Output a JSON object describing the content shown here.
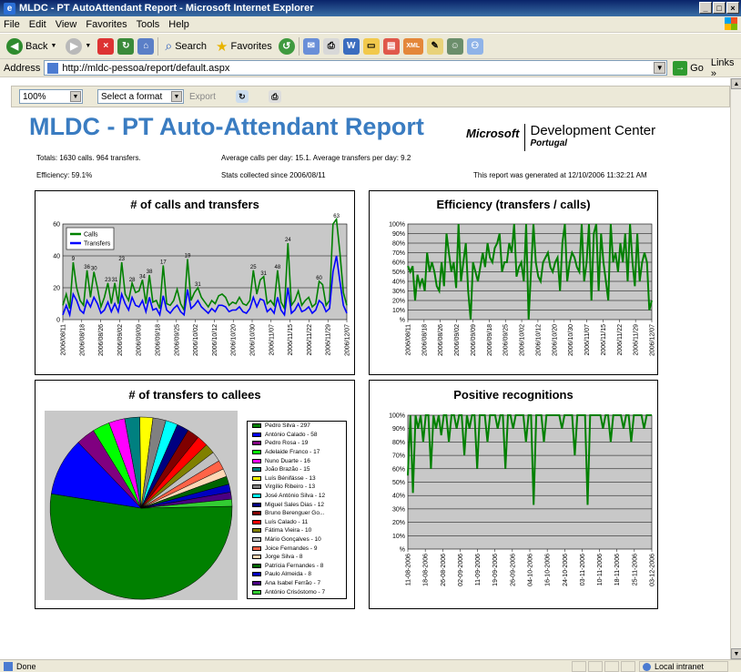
{
  "window": {
    "title": "MLDC - PT AutoAttendant Report - Microsoft Internet Explorer"
  },
  "menu": [
    "File",
    "Edit",
    "View",
    "Favorites",
    "Tools",
    "Help"
  ],
  "toolbar": {
    "back": "Back",
    "search": "Search",
    "favorites": "Favorites"
  },
  "address": {
    "label": "Address",
    "url": "http://mldc-pessoa/report/default.aspx",
    "go": "Go",
    "links": "Links"
  },
  "report_toolbar": {
    "zoom": "100%",
    "format": "Select a format",
    "export": "Export"
  },
  "report": {
    "title": "MLDC - PT Auto-Attendant Report",
    "logo": {
      "microsoft": "Microsoft",
      "dc": "Development Center",
      "country": "Portugal"
    },
    "totals": "Totals: 1630 calls. 964 transfers.",
    "averages": "Average calls per day: 15.1. Average transfers per day: 9.2",
    "efficiency": "Efficiency: 59.1%",
    "since": "Stats collected since 2006/08/11",
    "generated": "This report was generated at 12/10/2006 11:32:21 AM"
  },
  "chart_data": [
    {
      "type": "line",
      "title": "# of calls and transfers",
      "x_ticks": [
        "2006/08/11",
        "2006/08/18",
        "2006/08/26",
        "2006/09/02",
        "2006/09/09",
        "2006/09/18",
        "2006/09/25",
        "2006/10/02",
        "2006/10/12",
        "2006/10/20",
        "2006/10/30",
        "2006/11/07",
        "2006/11/15",
        "2006/11/22",
        "2006/11/29",
        "2006/12/07"
      ],
      "ylim": [
        0,
        60
      ],
      "y_ticks": [
        "0",
        "20",
        "40",
        "60"
      ],
      "legend_position": "top-left",
      "series": [
        {
          "name": "Calls",
          "color": "#008000",
          "values": [
            9,
            16,
            7,
            36,
            20,
            12,
            9,
            31,
            14,
            30,
            20,
            8,
            14,
            23,
            10,
            23,
            10,
            36,
            16,
            12,
            23,
            17,
            18,
            25,
            10,
            28,
            11,
            12,
            7,
            34,
            10,
            9,
            12,
            19,
            10,
            6,
            38,
            12,
            17,
            20,
            14,
            11,
            8,
            12,
            10,
            15,
            16,
            14,
            9,
            11,
            10,
            14,
            10,
            9,
            12,
            31,
            16,
            25,
            27,
            10,
            12,
            9,
            31,
            11,
            7,
            48,
            9,
            12,
            18,
            9,
            12,
            14,
            8,
            10,
            24,
            22,
            9,
            12,
            60,
            63,
            42,
            17,
            9
          ]
        },
        {
          "name": "Transfers",
          "color": "#0000ff",
          "values": [
            3,
            9,
            3,
            16,
            12,
            6,
            4,
            12,
            8,
            14,
            10,
            4,
            6,
            11,
            5,
            10,
            5,
            16,
            10,
            6,
            14,
            9,
            8,
            12,
            5,
            14,
            6,
            7,
            3,
            15,
            6,
            4,
            7,
            9,
            5,
            3,
            19,
            7,
            9,
            12,
            8,
            6,
            4,
            7,
            5,
            9,
            9,
            8,
            5,
            6,
            6,
            8,
            5,
            4,
            7,
            14,
            8,
            13,
            12,
            5,
            7,
            4,
            14,
            6,
            3,
            20,
            4,
            6,
            10,
            5,
            6,
            8,
            4,
            6,
            12,
            10,
            5,
            7,
            30,
            40,
            24,
            9,
            4
          ]
        }
      ],
      "data_labels": [
        "9",
        "36",
        "30",
        "23",
        "31",
        "23",
        "28",
        "34",
        "38",
        "17",
        "19",
        "31",
        "25",
        "31",
        "48",
        "24",
        "60",
        "63"
      ]
    },
    {
      "type": "line",
      "title": "Efficiency (transfers / calls)",
      "x_ticks": [
        "2006/08/11",
        "2006/08/18",
        "2006/08/26",
        "2006/09/02",
        "2006/09/09",
        "2006/09/18",
        "2006/09/25",
        "2006/10/02",
        "2006/10/12",
        "2006/10/20",
        "2006/10/30",
        "2006/11/07",
        "2006/11/15",
        "2006/11/22",
        "2006/11/29",
        "2006/12/07"
      ],
      "ylim": [
        0,
        100
      ],
      "y_ticks": [
        "%",
        "10%",
        "20%",
        "30%",
        "40%",
        "50%",
        "60%",
        "70%",
        "80%",
        "90%",
        "100%"
      ],
      "grid": true,
      "series": [
        {
          "name": "",
          "color": "#008000",
          "values": [
            56,
            50,
            56,
            20,
            47,
            35,
            43,
            30,
            70,
            50,
            60,
            50,
            35,
            30,
            60,
            35,
            90,
            70,
            50,
            60,
            33,
            100,
            40,
            60,
            80,
            30,
            0,
            60,
            50,
            40,
            55,
            70,
            55,
            80,
            65,
            60,
            75,
            80,
            90,
            50,
            60,
            60,
            80,
            70,
            100,
            45,
            55,
            60,
            40,
            100,
            0,
            50,
            100,
            60,
            45,
            40,
            60,
            65,
            70,
            55,
            50,
            60,
            65,
            30,
            80,
            100,
            40,
            60,
            70,
            65,
            55,
            50,
            100,
            40,
            60,
            100,
            20,
            90,
            100,
            30,
            90,
            60,
            40,
            20,
            100,
            60,
            70,
            50,
            80,
            60,
            90,
            40,
            100,
            60,
            35,
            90,
            40,
            60,
            70,
            60,
            10,
            20
          ]
        }
      ]
    },
    {
      "type": "pie",
      "title": "# of transfers to callees",
      "legend_position": "right",
      "slices": [
        {
          "label": "Pedro Silva - 297",
          "value": 297,
          "color": "#008000"
        },
        {
          "label": "António Calado - 58",
          "value": 58,
          "color": "#0000ff"
        },
        {
          "label": "Pedro Rosa - 19",
          "value": 19,
          "color": "#800080"
        },
        {
          "label": "Adelaide Franco - 17",
          "value": 17,
          "color": "#00ff00"
        },
        {
          "label": "Nuno Duarte - 16",
          "value": 16,
          "color": "#ff00ff"
        },
        {
          "label": "João Brazão - 15",
          "value": 15,
          "color": "#008080"
        },
        {
          "label": "Luís Bénifásse - 13",
          "value": 13,
          "color": "#ffff00"
        },
        {
          "label": "Virgílio Ribeiro - 13",
          "value": 13,
          "color": "#808080"
        },
        {
          "label": "José António Silva - 12",
          "value": 12,
          "color": "#00ffff"
        },
        {
          "label": "Miguel Sales Dias - 12",
          "value": 12,
          "color": "#000080"
        },
        {
          "label": "Bruno Berenguer Go...",
          "value": 12,
          "color": "#800000"
        },
        {
          "label": "Luís Calado - 11",
          "value": 11,
          "color": "#ff0000"
        },
        {
          "label": "Fátima Vieira - 10",
          "value": 10,
          "color": "#808000"
        },
        {
          "label": "Mário Gonçalves - 10",
          "value": 10,
          "color": "#c0c0c0"
        },
        {
          "label": "Joice Fernandes - 9",
          "value": 9,
          "color": "#ff6347"
        },
        {
          "label": "Jorge Silva - 8",
          "value": 8,
          "color": "#ffd7b5"
        },
        {
          "label": "Patrícia Fernandes - 8",
          "value": 8,
          "color": "#006400"
        },
        {
          "label": "Paulo Almeida - 8",
          "value": 8,
          "color": "#0000c0"
        },
        {
          "label": "Ana Isabel Ferrão - 7",
          "value": 7,
          "color": "#4b0082"
        },
        {
          "label": "António Crisóstomo - 7",
          "value": 7,
          "color": "#32cd32"
        }
      ]
    },
    {
      "type": "line",
      "title": "Positive recognitions",
      "x_ticks": [
        "11-08-2006",
        "18-08-2006",
        "26-08-2006",
        "02-09-2006",
        "11-09-2006",
        "19-09-2006",
        "26-09-2006",
        "04-10-2006",
        "16-10-2006",
        "24-10-2006",
        "03-11-2006",
        "10-11-2006",
        "18-11-2006",
        "25-11-2006",
        "03-12-2006"
      ],
      "ylim": [
        0,
        100
      ],
      "y_ticks": [
        "%",
        "10%",
        "20%",
        "30%",
        "40%",
        "50%",
        "60%",
        "70%",
        "80%",
        "90%",
        "100%"
      ],
      "grid": true,
      "series": [
        {
          "name": "",
          "color": "#008000",
          "values": [
            55,
            100,
            42,
            100,
            90,
            100,
            80,
            100,
            100,
            60,
            100,
            90,
            100,
            85,
            100,
            100,
            80,
            100,
            100,
            90,
            100,
            100,
            70,
            100,
            90,
            100,
            100,
            60,
            100,
            100,
            100,
            80,
            100,
            100,
            100,
            90,
            100,
            100,
            60,
            100,
            100,
            90,
            100,
            100,
            100,
            100,
            80,
            100,
            100,
            33,
            100,
            100,
            100,
            80,
            100,
            100,
            100,
            100,
            100,
            100,
            90,
            100,
            100,
            100,
            100,
            70,
            100,
            100,
            100,
            100,
            33,
            100,
            100,
            100,
            100,
            100,
            90,
            100,
            100,
            80,
            100,
            100,
            100,
            100,
            90,
            100,
            100,
            80,
            100,
            100,
            100,
            100,
            90,
            100,
            100,
            100
          ]
        }
      ]
    }
  ],
  "status": {
    "left": "Done",
    "zone": "Local intranet"
  }
}
